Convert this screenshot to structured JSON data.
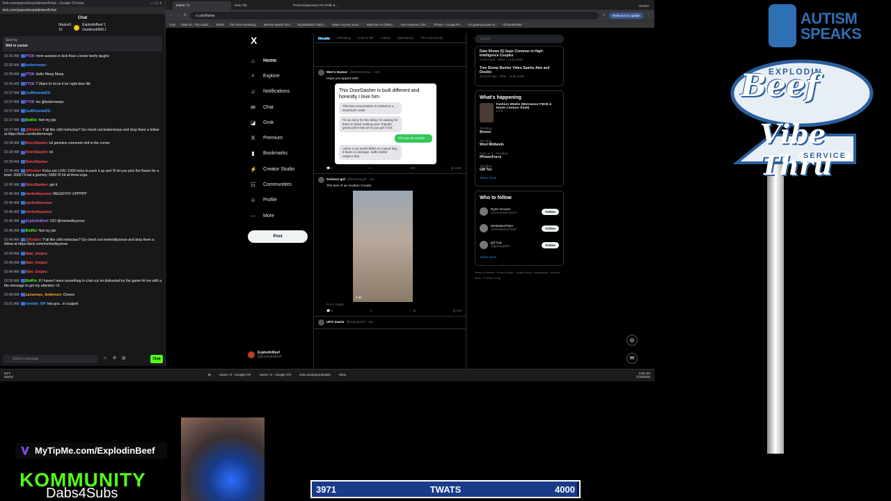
{
  "chat_window": {
    "title": "kick.com/popout/explodinbeef/chat - Google Chrome",
    "url": "kick.com/popout/explodinbeef/chat",
    "header": "Chat",
    "leaders": [
      {
        "name": "ExplodinBeef",
        "count": "1"
      },
      {
        "name": "Dankkush999",
        "count": "1"
      }
    ],
    "leader_side": [
      "Station5",
      "10"
    ],
    "pinned": {
      "sent_by": "Sent by",
      "text": "Shit in corner"
    },
    "messages": [
      {
        "time": "02:35 AM",
        "user": "PT28",
        "color": "#b16cff",
        "text": "more aussies in kick than u know beefy laughs"
      },
      {
        "time": "02:35 AM",
        "user": "butterneeps",
        "color": "#3aa0ff",
        "text": ""
      },
      {
        "time": "02:36 AM",
        "user": "PT28",
        "color": "#b16cff",
        "text": "Hello Meep Meep"
      },
      {
        "time": "02:36 AM",
        "user": "PT28",
        "color": "#b16cff",
        "text": "7.36pm fri lol so it be night time life"
      },
      {
        "time": "02:37 AM",
        "user": "GuiMirandaDS",
        "color": "#3aa0ff",
        "text": ""
      },
      {
        "time": "02:37 AM",
        "user": "PT28",
        "color": "#b16cff",
        "text": "lso @butterneeps"
      },
      {
        "time": "02:37 AM",
        "user": "GuiMirandaDS",
        "color": "#3aa0ff",
        "text": ""
      },
      {
        "time": "02:37 AM",
        "user": "BotRix",
        "color": "#53fc18",
        "text": "Not my job."
      },
      {
        "time": "02:37 AM",
        "user": "@Kicklet",
        "color": "#ff4b4b",
        "text": "Y'all like chill mofuckas? Go check out butterneeps and drop them a follow at https://kick.com/butterneeps"
      },
      {
        "time": "02:38 AM",
        "user": "RetroSlasher",
        "color": "#ff4b4b",
        "text": "lol jammins comment shit in the corner"
      },
      {
        "time": "02:38 AM",
        "user": "RetroSlasher",
        "color": "#ff4b4b",
        "text": "lol"
      },
      {
        "time": "02:39 AM",
        "user": "RetroSlasher",
        "color": "#ff4b4b",
        "text": ""
      },
      {
        "time": "02:44 AM",
        "user": "@Kicklet",
        "color": "#ff4b4b",
        "text": "Kicks are LIVE! 1000 kicks to pack it up and I'll let you pick the flower for a bowl. 2000 I'll eat a gummy. 5000 I'll hit all three ergs."
      },
      {
        "time": "02:45 AM",
        "user": "RetroSlasher",
        "color": "#ff4b4b",
        "text": "get it"
      },
      {
        "time": "02:46 AM",
        "user": "merkedbysnow",
        "color": "#ff4b4b",
        "text": "BEEEFFFF UPPPPP"
      },
      {
        "time": "02:46 AM",
        "user": "merkedbysnow",
        "color": "#ff4b4b",
        "text": ""
      },
      {
        "time": "02:46 AM",
        "user": "merkedbysnow",
        "color": "#ff4b4b",
        "text": ""
      },
      {
        "time": "02:46 AM",
        "user": "ExplodinBeef",
        "color": "#b16cff",
        "text": "ISO @merkedbysnow"
      },
      {
        "time": "02:46 AM",
        "user": "BotRix",
        "color": "#53fc18",
        "text": "Not my job."
      },
      {
        "time": "02:46 AM",
        "user": "@Kicklet",
        "color": "#ff4b4b",
        "text": "Y'all like chill mofuckas? Go check out merkedbysnow and drop them a follow at https://kick.com/merkedbysnow"
      },
      {
        "time": "02:49 AM",
        "user": "Nato_Snipes",
        "color": "#ff4b4b",
        "text": ""
      },
      {
        "time": "02:49 AM",
        "user": "Nato_Snipes",
        "color": "#ff4b4b",
        "text": ""
      },
      {
        "time": "02:49 AM",
        "user": "Nato_Snipes",
        "color": "#ff4b4b",
        "text": ""
      },
      {
        "time": "02:56 AM",
        "user": "BotRix",
        "color": "#53fc18",
        "text": "If I haven't seen something in chat cuz im distracted by the game hit me with a ftts message to get my attention <3"
      },
      {
        "time": "02:58 AM",
        "user": "Larserous_Anderson",
        "color": "#ffb020",
        "text": "Cheers"
      },
      {
        "time": "03:01 AM",
        "user": "ronaldo_RP",
        "color": "#3aa0ff",
        "text": "lets goo.. in support"
      }
    ],
    "input_placeholder": "Send a message",
    "send_label": "Chat"
  },
  "browser": {
    "tabs": [
      "Home / X",
      "New Tab",
      "Roots Dispensary Pre Rolls & ...",
      "Gemini"
    ],
    "url": "x.com/home",
    "relaunch": "Relaunch to update",
    "bookmarks": [
      "Kick",
      "Slate.sh - The Leadi...",
      "Twitch",
      "The best streaming...",
      "Internet Speed Test...",
      "ExplodinBeef Sails |...",
      "Make Any Mic Soun...",
      "Welcome to Clikkro...",
      "Your Purpose | Libr...",
      "Photos - Google Ph...",
      "I'm gaming issues w...",
      "All Bookmarks"
    ]
  },
  "x_nav": {
    "logo": "X",
    "items": [
      {
        "icon": "⌂",
        "label": "Home"
      },
      {
        "icon": "⌕",
        "label": "Explore"
      },
      {
        "icon": "♫",
        "label": "Notifications"
      },
      {
        "icon": "✉",
        "label": "Chat"
      },
      {
        "icon": "◪",
        "label": "Grok"
      },
      {
        "icon": "X",
        "label": "Premium"
      },
      {
        "icon": "▮",
        "label": "Bookmarks"
      },
      {
        "icon": "⚡",
        "label": "Creator Studio"
      },
      {
        "icon": "☷",
        "label": "Communities"
      },
      {
        "icon": "☺",
        "label": "Profile"
      },
      {
        "icon": "⋯",
        "label": "More"
      }
    ],
    "post_button": "Post",
    "profile_name": "ExplodinBeef",
    "profile_handle": "@ExplodinBeef"
  },
  "feed": {
    "tabs": [
      "For you",
      "Following",
      "Kush N Tell",
      "Autism",
      "AlphaSleep",
      "The Community"
    ],
    "post1": {
      "name": "Men's Humor",
      "handle": "@MensHumor · 13h",
      "text": "Hope you tipped well!",
      "card_caption": "This DoorDasher is built different and honestly I love him",
      "bubble1": "This text conversation is related to a DoorDash order.",
      "bubble2": "I'm so sorry for the delay I'm waiting for them to finish making your chipotle. gonna drive fast af so you get it hot",
      "bubble3": "Ok man be careful",
      "bubble4": "i drive a car worth $900 on a good day, it fears no damage. traffic better respect that",
      "stats": [
        "6",
        "",
        "10K",
        "125K"
      ]
    },
    "post2": {
      "name": "Science girl",
      "handle": "@sciencegirl · 3m",
      "text": "The size of an Andean Condor",
      "video_time": "0:32",
      "source": "From Sadie",
      "stats": [
        "5",
        "",
        "16",
        "693"
      ]
    },
    "post3": {
      "name": "UFO mania",
      "handle": "@maniaUFO · 2m"
    }
  },
  "right": {
    "search_placeholder": "Search",
    "news": [
      {
        "title": "Data Shows IQ Gaps Common in High-Intelligence Couples",
        "meta": "2 hours ago · Other · 2,142 posts"
      },
      {
        "title": "Tree Stump Bunker Video Sparks Awe and Doubts",
        "meta": "15 hours ago · Other · 11.6K posts"
      }
    ],
    "happening_title": "What's happening",
    "happening_card": "Fashion Weeks (Menswear FW26 & Haute Couture SS26)",
    "happening_meta": "LIVE",
    "trends": [
      {
        "cat": "Trending",
        "name": "$moos"
      },
      {
        "cat": "Trending",
        "name": "West Midlands"
      },
      {
        "cat": "Only on X · Trending",
        "name": "#PowerForce"
      },
      {
        "cat": "Trending",
        "name": "GM Toz"
      }
    ],
    "show_more": "Show more",
    "wtf_title": "Who to follow",
    "follow": [
      {
        "name": "Ryan Graves",
        "handle": "@uncertainvector"
      },
      {
        "name": "MrsBakedTater",
        "handle": "@MrsBakedTater"
      },
      {
        "name": "jyd nug",
        "handle": "@jydnug666"
      }
    ],
    "follow_label": "Follow",
    "footer": "Terms of Service · Privacy Policy · Cookie Policy · Accessibility · Ads info · More · © 2026 X Corp."
  },
  "taskbar": {
    "weather_temp": "54°F",
    "weather_desc": "Sunny",
    "apps": [
      "Home / X - Google Chr",
      "Home / X - Google Chr",
      "kick.com/popout/explo",
      "Xbox"
    ],
    "time": "3:02 AM",
    "date": "1/16/2026"
  },
  "overlays": {
    "autism_line1": "AUTISM",
    "autism_line2": "SPEAKS",
    "sign_top": "EXPLODIN",
    "sign_beef": "Beef",
    "sign_vibe": "Vibe Thru",
    "sign_service": "SERVICE",
    "tipme": "MyTipMe.com/ExplodinBeef",
    "kommunity": "KOMMUNITY",
    "dabs": "Dabs4Subs",
    "goal_current": "3971",
    "goal_label": "TWATS",
    "goal_target": "4000",
    "goal_progress": 0.99275
  },
  "colors": {
    "kick_green": "#53fc18",
    "x_blue": "#1d9bf0",
    "brand_blue": "#2f6fb3"
  }
}
